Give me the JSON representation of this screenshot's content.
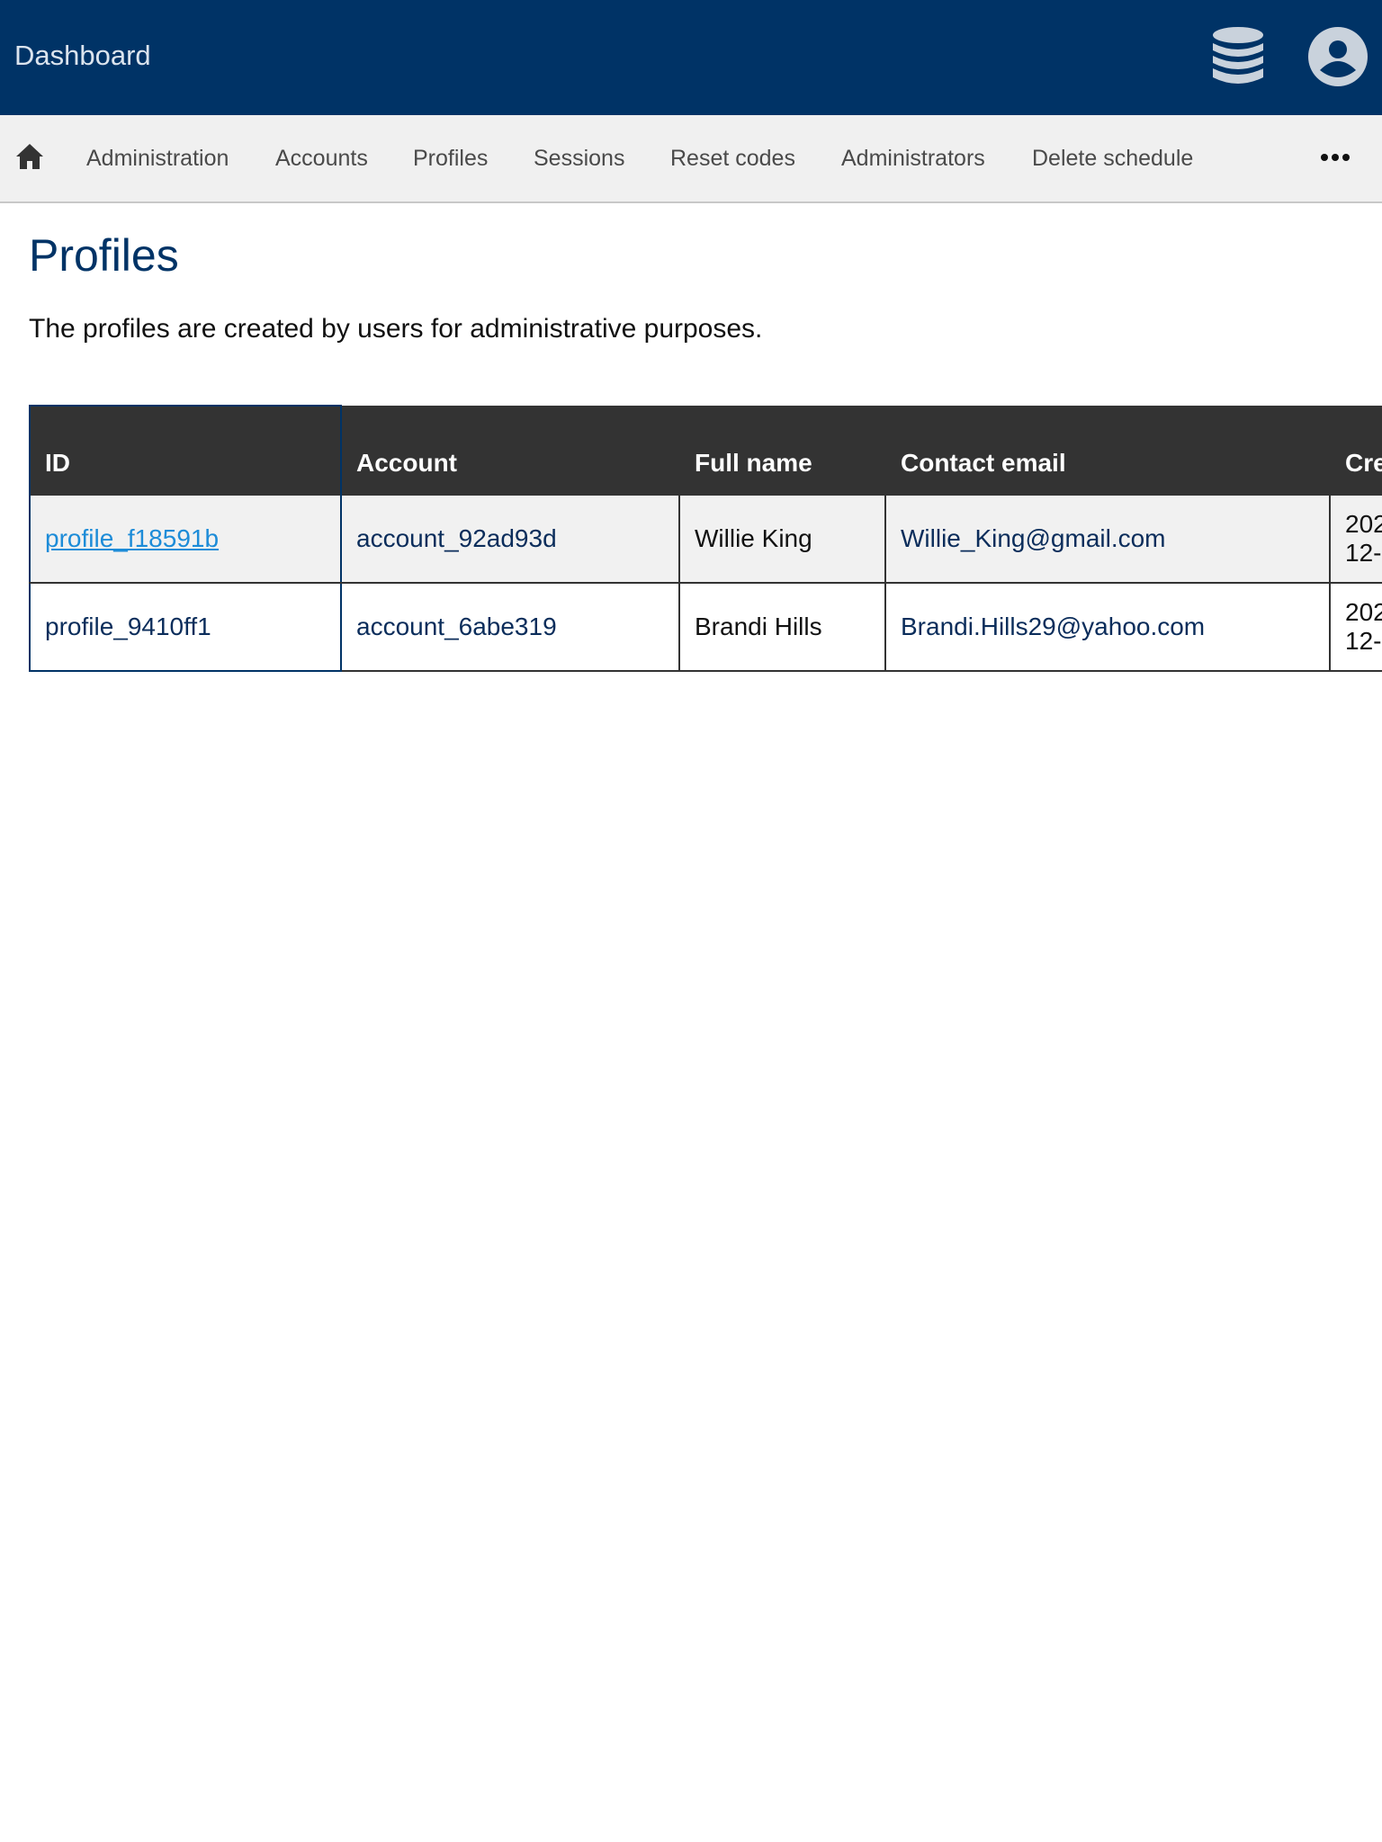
{
  "header": {
    "title": "Dashboard",
    "background": "#003366",
    "icons": [
      "database-icon",
      "account-circle-icon"
    ]
  },
  "nav": {
    "home_icon": "home-icon",
    "items": [
      {
        "label": "Administration"
      },
      {
        "label": "Accounts"
      },
      {
        "label": "Profiles"
      },
      {
        "label": "Sessions"
      },
      {
        "label": "Reset codes"
      },
      {
        "label": "Administrators"
      },
      {
        "label": "Delete schedule"
      }
    ],
    "more_icon": "more-horizontal-icon"
  },
  "main": {
    "title": "Profiles",
    "description": "The profiles are created by users for administrative purposes."
  },
  "table": {
    "columns": [
      "ID",
      "Account",
      "Full name",
      "Contact email",
      "Cre"
    ],
    "rows": [
      {
        "id": "profile_f18591b",
        "account": "account_92ad93d",
        "full_name": "Willie King",
        "email": "Willie_King@gmail.com",
        "created": "202 12-"
      },
      {
        "id": "profile_9410ff1",
        "account": "account_6abe319",
        "full_name": "Brandi Hills",
        "email": "Brandi.Hills29@yahoo.com",
        "created": "202 12-"
      }
    ]
  },
  "colors": {
    "brand_navy": "#003366",
    "link_blue": "#1d8cd8",
    "table_header": "#333333",
    "nav_background": "#f0f0f0"
  }
}
